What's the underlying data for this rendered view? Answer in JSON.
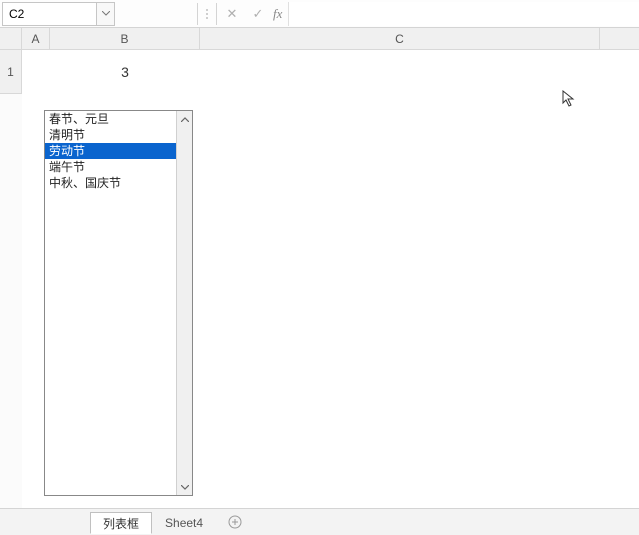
{
  "name_box": {
    "value": "C2"
  },
  "formula_bar": {
    "cancel": "✕",
    "confirm": "✓",
    "fx": "fx",
    "value": ""
  },
  "columns": {
    "A": "A",
    "B": "B",
    "C": "C"
  },
  "rows": {
    "r1": "1"
  },
  "cells": {
    "b1": "3"
  },
  "listbox": {
    "items": [
      {
        "label": "春节、元旦",
        "selected": false
      },
      {
        "label": "清明节",
        "selected": false
      },
      {
        "label": "劳动节",
        "selected": true
      },
      {
        "label": "端午节",
        "selected": false
      },
      {
        "label": "中秋、国庆节",
        "selected": false
      }
    ]
  },
  "tabs": {
    "active": "列表框",
    "other": "Sheet4",
    "add": "+"
  }
}
